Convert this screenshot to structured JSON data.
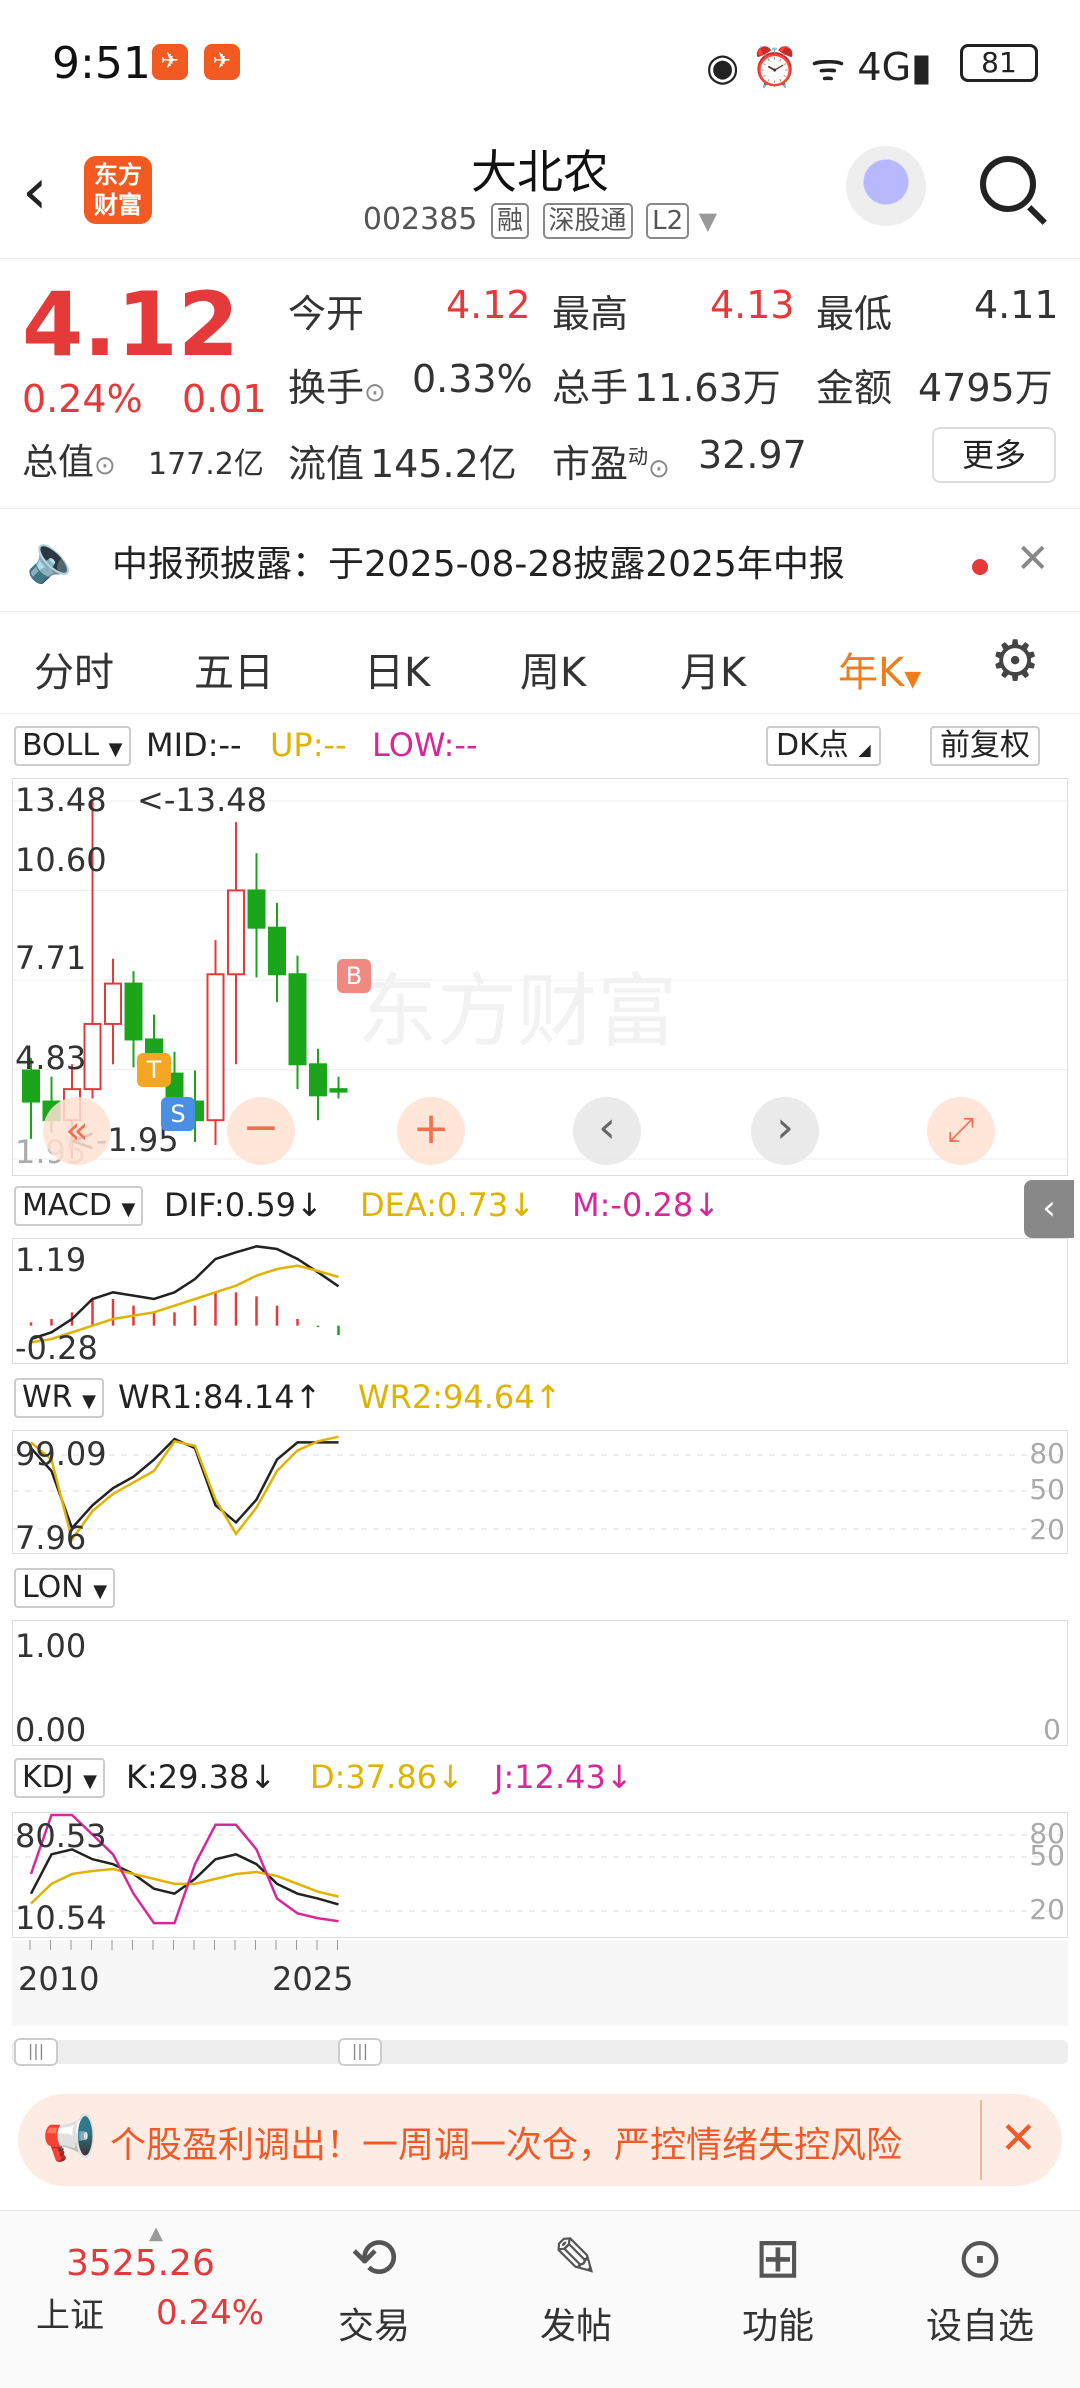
{
  "status": {
    "time": "9:51",
    "battery": "81"
  },
  "header": {
    "title": "大北农",
    "code": "002385",
    "tags": [
      "融",
      "深股通",
      "L2"
    ],
    "logo": "东方财富"
  },
  "quote": {
    "price": "4.12",
    "change_pct": "0.24%",
    "change": "0.01",
    "open_label": "今开",
    "open": "4.12",
    "high_label": "最高",
    "high": "4.13",
    "low_label": "最低",
    "low": "4.11",
    "turnover_label": "换手",
    "turnover": "0.33%",
    "volume_label": "总手",
    "volume": "11.63万",
    "amount_label": "金额",
    "amount": "4795万",
    "mcap_label": "总值",
    "mcap": "177.2亿",
    "float_label": "流值",
    "float": "145.2亿",
    "pe_label": "市盈",
    "pe_sup": "动",
    "pe": "32.97",
    "more": "更多"
  },
  "notice": {
    "text": "中报预披露：于2025-08-28披露2025年中报"
  },
  "tabs": [
    "分时",
    "五日",
    "日K",
    "周K",
    "月K",
    "年K"
  ],
  "active_tab": "年K",
  "boll": {
    "name": "BOLL",
    "mid": "MID:--",
    "up": "UP:--",
    "low": "LOW:--",
    "dk": "DK点",
    "fq": "前复权",
    "y_labels": [
      "13.48",
      "10.60",
      "7.71",
      "4.83",
      "1.95"
    ],
    "max_note": "<-13.48",
    "min_note": "<-1.95",
    "marker_b": "B",
    "marker_s": "S",
    "marker_t": "T"
  },
  "macd": {
    "name": "MACD",
    "dif": "DIF:0.59↓",
    "dea": "DEA:0.73↓",
    "m": "M:-0.28↓",
    "y_top": "1.19",
    "y_bot": "-0.28"
  },
  "wr": {
    "name": "WR",
    "wr1": "WR1:84.14↑",
    "wr2": "WR2:94.64↑",
    "y_top": "99.09",
    "y_bot": "7.96",
    "r_levels": [
      "80",
      "50",
      "20"
    ]
  },
  "lon": {
    "name": "LON",
    "y_top": "1.00",
    "y_bot": "0.00",
    "r_level": "0"
  },
  "kdj": {
    "name": "KDJ",
    "k": "K:29.38↓",
    "d": "D:37.86↓",
    "j": "J:12.43↓",
    "y_top": "80.53",
    "y_bot": "10.54",
    "r_levels": [
      "80",
      "50",
      "20"
    ]
  },
  "x_axis": {
    "start": "2010",
    "end": "2025"
  },
  "ad": {
    "text": "个股盈利调出！一周调一次仓，严控情绪失控风险"
  },
  "bottom": {
    "index_value": "3525.26",
    "index_name": "上证",
    "index_pct": "0.24%",
    "nav": [
      "交易",
      "发帖",
      "功能",
      "设自选"
    ]
  },
  "colors": {
    "up": "#e5393a",
    "down": "#1aa51a",
    "accent": "#ef7d1c",
    "gold": "#e0b300",
    "magenta": "#d6289b"
  },
  "chart_data": {
    "type": "candlestick",
    "x": [
      "2010",
      "2011",
      "2012",
      "2013",
      "2014",
      "2015",
      "2016",
      "2017",
      "2018",
      "2019",
      "2020",
      "2021",
      "2022",
      "2023",
      "2024",
      "2025"
    ],
    "open": [
      4.8,
      3.8,
      3.2,
      4.2,
      6.3,
      7.6,
      5.8,
      4.7,
      3.8,
      3.2,
      7.9,
      10.6,
      9.4,
      7.9,
      5.0,
      4.2
    ],
    "close": [
      3.8,
      3.2,
      4.2,
      6.3,
      7.6,
      5.8,
      4.7,
      3.8,
      3.2,
      7.9,
      10.6,
      9.4,
      7.9,
      5.0,
      4.0,
      4.12
    ],
    "high": [
      5.2,
      4.6,
      5.0,
      13.48,
      8.4,
      8.0,
      6.6,
      5.4,
      4.8,
      9.0,
      12.8,
      11.8,
      10.2,
      8.5,
      5.5,
      4.6
    ],
    "low": [
      2.6,
      2.8,
      1.95,
      3.9,
      5.0,
      4.9,
      4.3,
      3.1,
      2.5,
      2.4,
      5.0,
      7.8,
      7.0,
      4.2,
      3.2,
      3.9
    ]
  }
}
